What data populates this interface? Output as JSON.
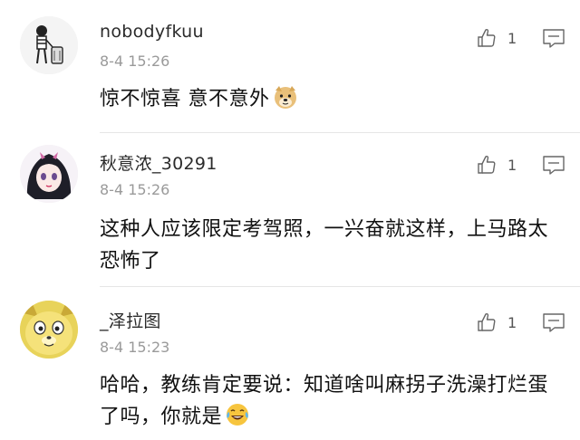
{
  "comments": [
    {
      "username": "nobodyfkuu",
      "timestamp": "8-4 15:26",
      "text": "惊不惊喜 意不意外",
      "emoji": "doge-emoji",
      "likes": "1",
      "avatar": "cartoon-person-avatar"
    },
    {
      "username": "秋意浓_30291",
      "timestamp": "8-4 15:26",
      "text": "这种人应该限定考驾照，一兴奋就这样，上马路太恐怖了",
      "emoji": null,
      "likes": "1",
      "avatar": "anime-girl-avatar"
    },
    {
      "username": "_泽拉图",
      "timestamp": "8-4 15:23",
      "text": "哈哈，教练肯定要说：知道啥叫麻拐子洗澡打烂蛋了吗，你就是",
      "emoji": "laugh-cry-emoji",
      "likes": "1",
      "avatar": "yellow-cartoon-avatar"
    }
  ],
  "icons": {
    "like": "thumbs-up-icon",
    "reply": "comment-bubble-icon"
  }
}
